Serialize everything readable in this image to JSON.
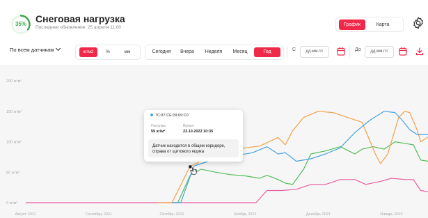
{
  "header": {
    "gauge_percent": "35%",
    "gauge_fraction": 0.35,
    "title": "Снеговая нагрузка",
    "subtitle": "Последнее обновление: 25 апреля 11:00",
    "view_tabs": [
      "График",
      "Карта"
    ],
    "active_view": "График"
  },
  "toolbar": {
    "sensor_select": "По всем датчикам",
    "units": [
      "кг/м2",
      "%",
      "мм"
    ],
    "active_unit": "кг/м2",
    "periods": [
      "Сегодня",
      "Вчера",
      "Неделя",
      "Месяц",
      "Год"
    ],
    "active_period": "Год",
    "from_label": "С",
    "to_label": "До",
    "date_placeholder": "дд.мм.ггг"
  },
  "tooltip": {
    "sensor_id": "7C:87:CE:09:69:C0",
    "load_header": "Нагрузка",
    "time_header": "Время",
    "load_value": "59 кг/м²",
    "time_value": "23.10.2022 10:35",
    "note": "Датчик находится в общем коридоре, справа от щитового ящика"
  },
  "colors": {
    "accent": "#f02849",
    "gauge": "#3aa64a",
    "series_blue": "#4aa3df",
    "series_orange": "#f4a04a",
    "series_green": "#4fbf56",
    "series_pink": "#e85fa0"
  },
  "chart_data": {
    "type": "line",
    "ylabel_ticks": [
      "200 кг/м²",
      "150 кг/м²",
      "100 кг/м²",
      "50 кг/м²",
      "0 кг/м²"
    ],
    "y_values": [
      200,
      150,
      100,
      50,
      0
    ],
    "ylim": [
      0,
      215
    ],
    "x_tick_labels": [
      "Август 2021",
      "Сентябрь 2021",
      "Октябрь 2021",
      "Ноябрь 2021",
      "Декабрь 2021",
      "Январь 2022"
    ],
    "x_ticks": [
      0,
      1,
      2,
      3,
      4,
      5
    ],
    "xlim": [
      -0.35,
      5.5
    ],
    "grid": false,
    "series": [
      {
        "color": "#f4a04a",
        "points": [
          [
            1.8,
            0
          ],
          [
            2.0,
            0
          ],
          [
            2.25,
            60
          ],
          [
            2.35,
            65
          ],
          [
            2.45,
            78
          ],
          [
            2.6,
            80
          ],
          [
            2.8,
            85
          ],
          [
            3.0,
            90
          ],
          [
            3.2,
            93
          ],
          [
            3.45,
            107
          ],
          [
            3.55,
            95
          ],
          [
            3.65,
            118
          ],
          [
            3.8,
            140
          ],
          [
            4.0,
            150
          ],
          [
            4.2,
            148
          ],
          [
            4.4,
            140
          ],
          [
            4.6,
            132
          ],
          [
            4.78,
            80
          ],
          [
            4.85,
            64
          ],
          [
            4.95,
            80
          ],
          [
            5.1,
            140
          ],
          [
            5.18,
            150
          ],
          [
            5.25,
            148
          ],
          [
            5.35,
            120
          ],
          [
            5.4,
            100
          ],
          [
            5.5,
            108
          ]
        ]
      },
      {
        "color": "#4aa3df",
        "points": [
          [
            2.0,
            0
          ],
          [
            2.12,
            0
          ],
          [
            2.3,
            60
          ],
          [
            2.5,
            68
          ],
          [
            2.7,
            73
          ],
          [
            2.9,
            78
          ],
          [
            3.1,
            82
          ],
          [
            3.3,
            92
          ],
          [
            3.45,
            80
          ],
          [
            3.55,
            82
          ],
          [
            3.7,
            68
          ],
          [
            3.9,
            72
          ],
          [
            4.1,
            80
          ],
          [
            4.3,
            90
          ],
          [
            4.5,
            115
          ],
          [
            4.7,
            135
          ],
          [
            4.9,
            150
          ],
          [
            5.05,
            148
          ],
          [
            5.15,
            135
          ],
          [
            5.25,
            120
          ],
          [
            5.35,
            112
          ],
          [
            5.45,
            112
          ],
          [
            5.5,
            112
          ]
        ]
      },
      {
        "color": "#4fbf56",
        "points": [
          [
            2.0,
            0
          ],
          [
            2.08,
            0
          ],
          [
            2.25,
            45
          ],
          [
            2.4,
            55
          ],
          [
            2.6,
            50
          ],
          [
            2.8,
            46
          ],
          [
            3.0,
            44
          ],
          [
            3.2,
            40
          ],
          [
            3.3,
            45
          ],
          [
            3.45,
            38
          ],
          [
            3.55,
            32
          ],
          [
            3.65,
            30
          ],
          [
            3.8,
            55
          ],
          [
            3.9,
            80
          ],
          [
            4.1,
            85
          ],
          [
            4.3,
            92
          ],
          [
            4.5,
            80
          ],
          [
            4.6,
            88
          ],
          [
            4.75,
            92
          ],
          [
            4.9,
            88
          ],
          [
            5.05,
            100
          ],
          [
            5.15,
            98
          ],
          [
            5.3,
            95
          ],
          [
            5.4,
            70
          ],
          [
            5.5,
            68
          ]
        ]
      },
      {
        "color": "#e85fa0",
        "points": [
          [
            0,
            0
          ],
          [
            2.5,
            0
          ],
          [
            3.15,
            0
          ],
          [
            3.3,
            20
          ],
          [
            3.5,
            20
          ],
          [
            3.7,
            22
          ],
          [
            3.9,
            30
          ],
          [
            4.1,
            30
          ],
          [
            4.3,
            38
          ],
          [
            4.5,
            38
          ],
          [
            4.65,
            30
          ],
          [
            4.85,
            35
          ],
          [
            5.0,
            40
          ],
          [
            5.2,
            38
          ],
          [
            5.3,
            38
          ],
          [
            5.4,
            20
          ],
          [
            5.5,
            18
          ]
        ]
      }
    ]
  }
}
